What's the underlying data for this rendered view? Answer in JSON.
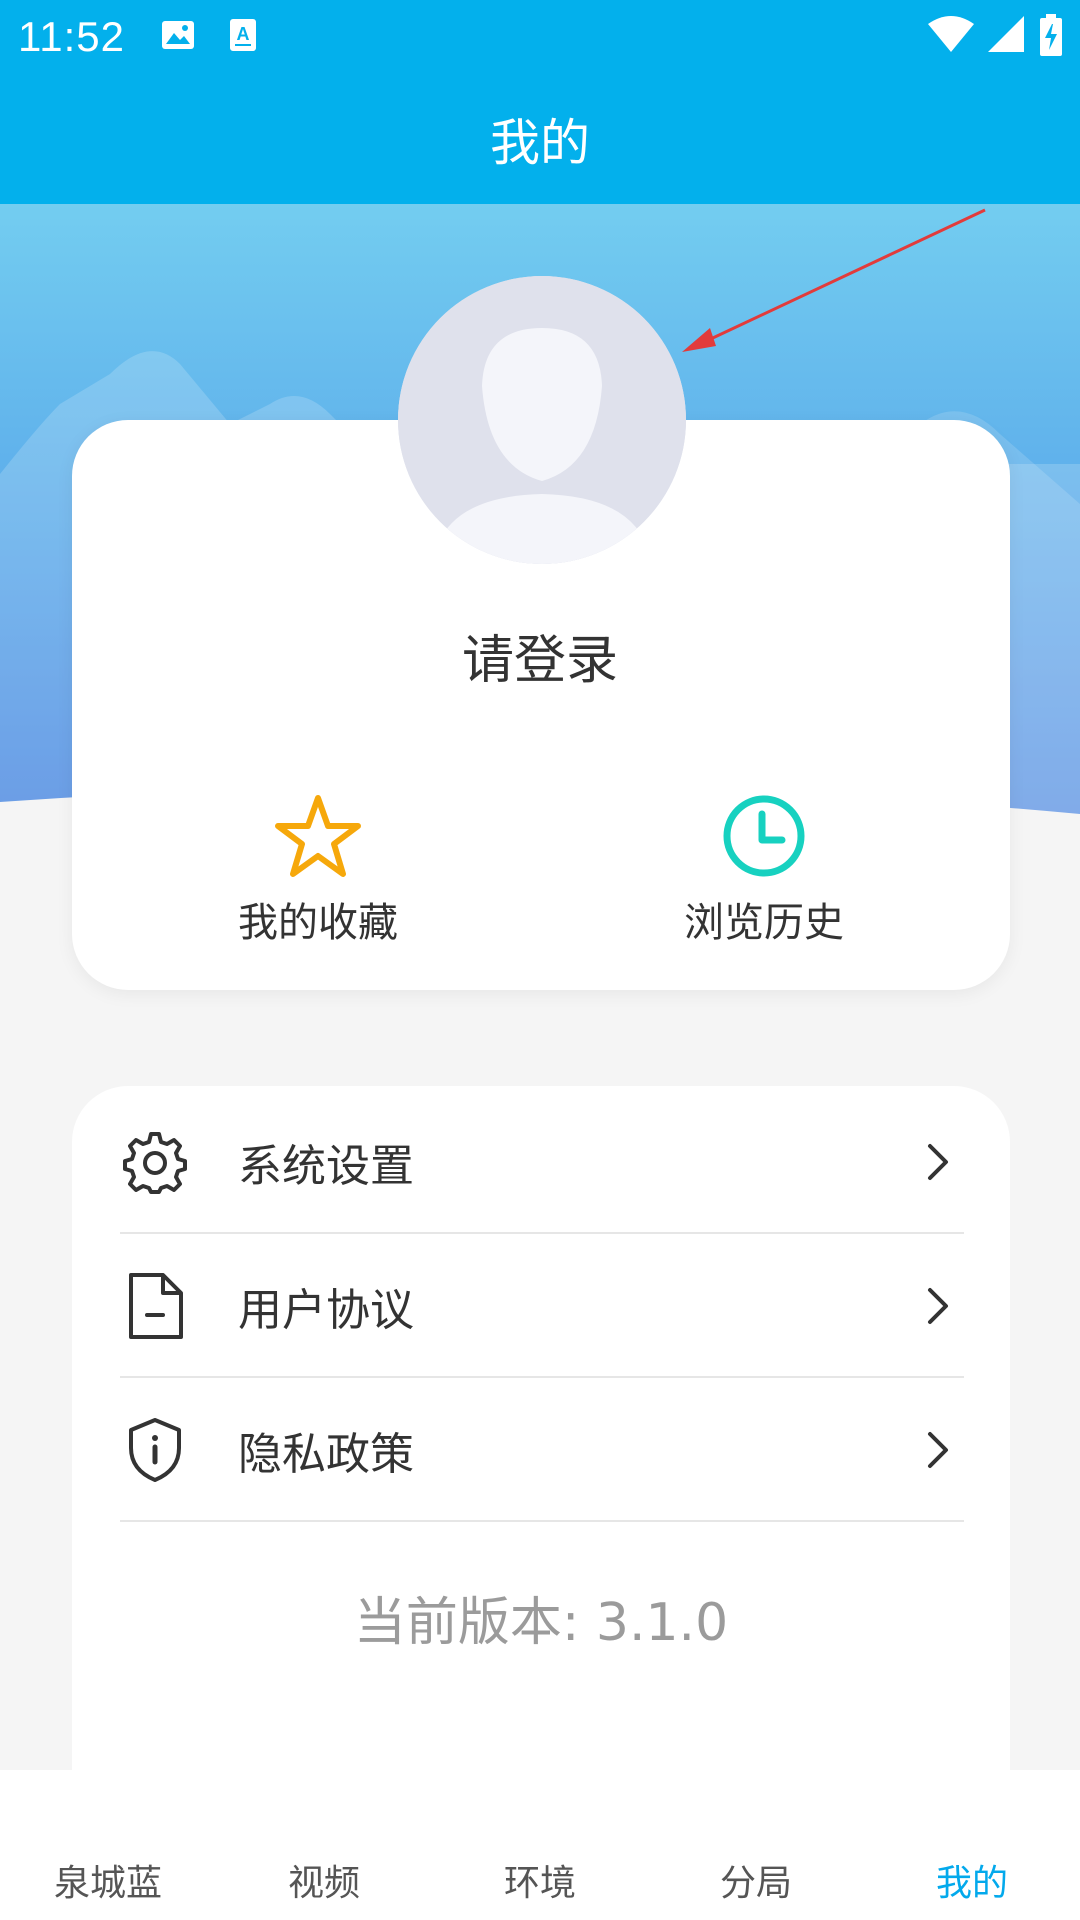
{
  "status_bar": {
    "time": "11:52",
    "icons": [
      "image-notification-icon",
      "text-notification-icon",
      "wifi-icon",
      "signal-icon",
      "battery-charging-icon"
    ]
  },
  "header": {
    "title": "我的"
  },
  "profile": {
    "login_prompt": "请登录",
    "quick_actions": [
      {
        "label": "我的收藏",
        "icon": "star-icon",
        "color": "#f6a80b"
      },
      {
        "label": "浏览历史",
        "icon": "clock-icon",
        "color": "#17d1c0"
      }
    ]
  },
  "menu": {
    "items": [
      {
        "label": "系统设置",
        "icon": "gear-icon"
      },
      {
        "label": "用户协议",
        "icon": "document-icon"
      },
      {
        "label": "隐私政策",
        "icon": "shield-info-icon"
      }
    ],
    "version": "当前版本: 3.1.0"
  },
  "bottom_nav": {
    "items": [
      {
        "label": "泉城蓝"
      },
      {
        "label": "视频"
      },
      {
        "label": "环境"
      },
      {
        "label": "分局"
      },
      {
        "label": "我的"
      }
    ],
    "active_index": 4
  },
  "colors": {
    "primary": "#03b0ec",
    "active_nav": "#03a9ec",
    "annotation": "#e23b3b"
  }
}
